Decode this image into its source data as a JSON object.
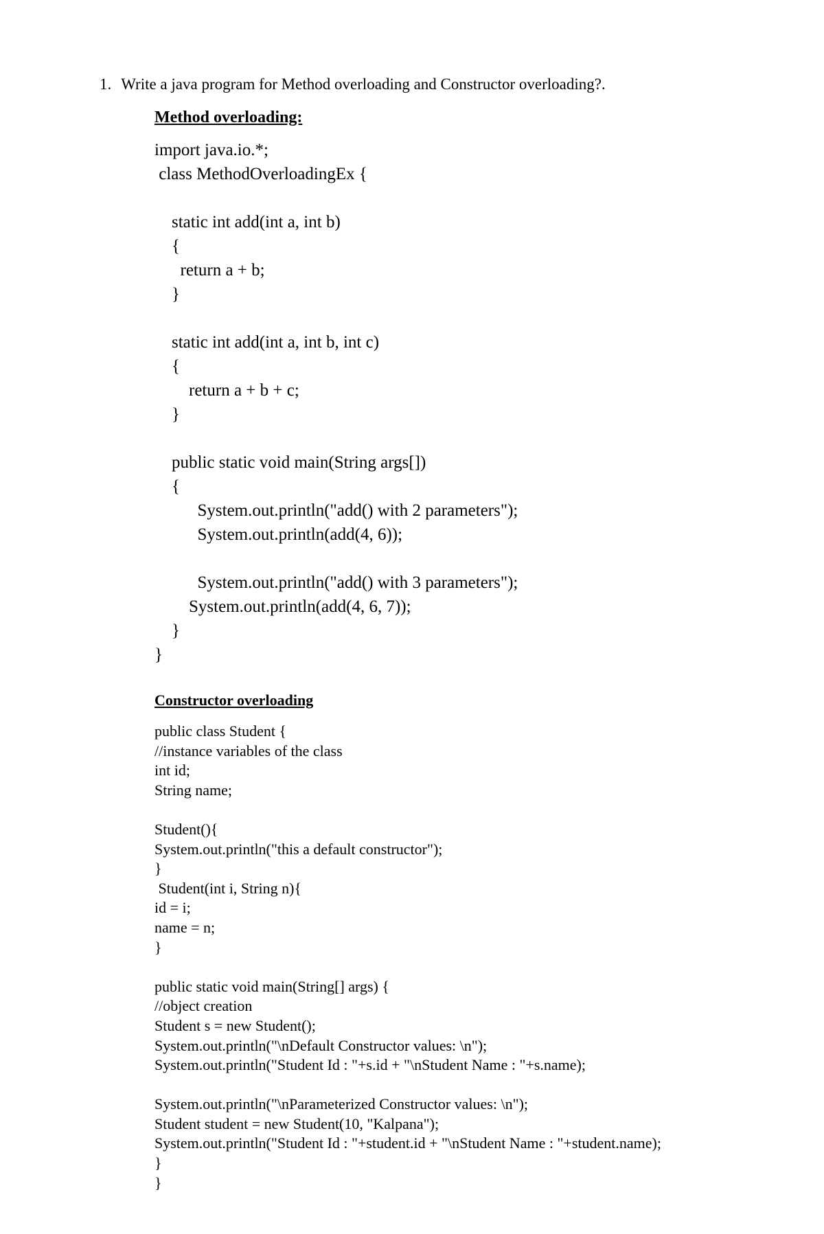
{
  "question": {
    "number": "1.",
    "text": "Write a java program for Method overloading and Constructor overloading?."
  },
  "section1": {
    "heading": "Method overloading:",
    "code": "import java.io.*;\n class MethodOverloadingEx {\n\n    static int add(int a, int b)\n    {\n      return a + b;\n    }\n\n    static int add(int a, int b, int c)\n    {\n        return a + b + c;\n    }\n\n    public static void main(String args[])\n    {\n          System.out.println(\"add() with 2 parameters\");\n          System.out.println(add(4, 6));\n\n          System.out.println(\"add() with 3 parameters\");\n        System.out.println(add(4, 6, 7));\n    }\n}"
  },
  "section2": {
    "heading": "Constructor overloading",
    "code": "public class Student {\n//instance variables of the class\nint id;\nString name;\n\nStudent(){\nSystem.out.println(\"this a default constructor\");\n}\n Student(int i, String n){\nid = i;\nname = n;\n}\n\npublic static void main(String[] args) {\n//object creation\nStudent s = new Student();\nSystem.out.println(\"\\nDefault Constructor values: \\n\");\nSystem.out.println(\"Student Id : \"+s.id + \"\\nStudent Name : \"+s.name);\n\nSystem.out.println(\"\\nParameterized Constructor values: \\n\");\nStudent student = new Student(10, \"Kalpana\");\nSystem.out.println(\"Student Id : \"+student.id + \"\\nStudent Name : \"+student.name);\n}\n}"
  }
}
